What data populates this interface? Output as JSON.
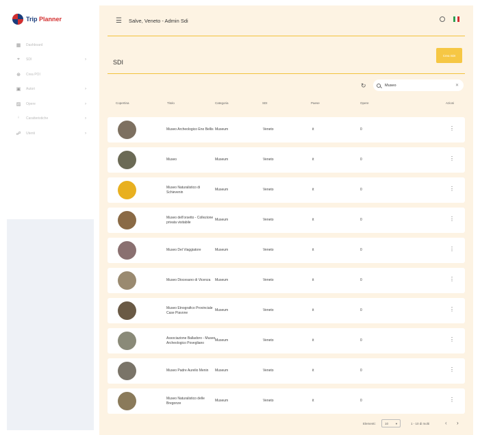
{
  "app": {
    "logo_part1": "Trip ",
    "logo_part2": "Planner",
    "brand_color": "#d32f2f",
    "accent_color": "#f6c744"
  },
  "sidebar": {
    "items": [
      {
        "label": "Dashboard",
        "icon": "dashboard-icon",
        "glyph": "▦",
        "has_chevron": false
      },
      {
        "label": "SDI",
        "icon": "location-pin-icon",
        "glyph": "⌖",
        "has_chevron": true
      },
      {
        "label": "Crea POI",
        "icon": "add-circle-icon",
        "glyph": "⊕",
        "has_chevron": false
      },
      {
        "label": "Autori",
        "icon": "person-card-icon",
        "glyph": "▣",
        "has_chevron": true
      },
      {
        "label": "Opere",
        "icon": "image-icon",
        "glyph": "▨",
        "has_chevron": true
      },
      {
        "label": "Caratteristiche",
        "icon": "info-icon",
        "glyph": "ⁱ",
        "has_chevron": true
      },
      {
        "label": "Utenti",
        "icon": "users-icon",
        "glyph": "☍",
        "has_chevron": true
      }
    ]
  },
  "header": {
    "greeting": "Salve, Veneto - Admin Sdi",
    "language_flag": "italian-flag-icon"
  },
  "page": {
    "title": "SDI",
    "create_button": "Crea SDI"
  },
  "search": {
    "value": "Museo"
  },
  "table": {
    "columns": [
      "Copertina",
      "Titolo",
      "Categoria",
      "SDI",
      "Paese",
      "Opere",
      "Azioni"
    ],
    "rows": [
      {
        "title": "Museo Archeologico Eno Bellis",
        "category": "Museum",
        "sdi": "Veneto",
        "country": "it",
        "works": "0",
        "thumb": "#7d7060"
      },
      {
        "title": "Museo",
        "category": "Museum",
        "sdi": "Veneto",
        "country": "it",
        "works": "0",
        "thumb": "#6b6a55"
      },
      {
        "title": "Museo Naturalistico di Schievenin",
        "category": "Museum",
        "sdi": "Veneto",
        "country": "it",
        "works": "0",
        "thumb": "#e8b020"
      },
      {
        "title": "Museo dell'orsetto - Collezione privata visitabile",
        "category": "Museum",
        "sdi": "Veneto",
        "country": "it",
        "works": "0",
        "thumb": "#8a6a45"
      },
      {
        "title": "Museo Del Viaggiatore",
        "category": "Museum",
        "sdi": "Veneto",
        "country": "it",
        "works": "0",
        "thumb": "#8a7070"
      },
      {
        "title": "Museo Diocesano di Vicenza",
        "category": "Museum",
        "sdi": "Veneto",
        "country": "it",
        "works": "0",
        "thumb": "#9a8a70"
      },
      {
        "title": "Museo Etnografico Provinciale Case Piavone",
        "category": "Museum",
        "sdi": "Veneto",
        "country": "it",
        "works": "0",
        "thumb": "#6a5a45"
      },
      {
        "title": "Associazione Balladoro - Museo Archeologico Povegliano",
        "category": "Museum",
        "sdi": "Veneto",
        "country": "it",
        "works": "0",
        "thumb": "#8a8a78"
      },
      {
        "title": "Museo Padre Aurelio Menin",
        "category": "Museum",
        "sdi": "Veneto",
        "country": "it",
        "works": "0",
        "thumb": "#7a7468"
      },
      {
        "title": "Museo Naturalistico delle Bregonze",
        "category": "Museum",
        "sdi": "Veneto",
        "country": "it",
        "works": "0",
        "thumb": "#8a7a5a"
      }
    ]
  },
  "pagination": {
    "label": "Elementi:",
    "page_size": "10",
    "range": "1 - 10 di molti"
  }
}
